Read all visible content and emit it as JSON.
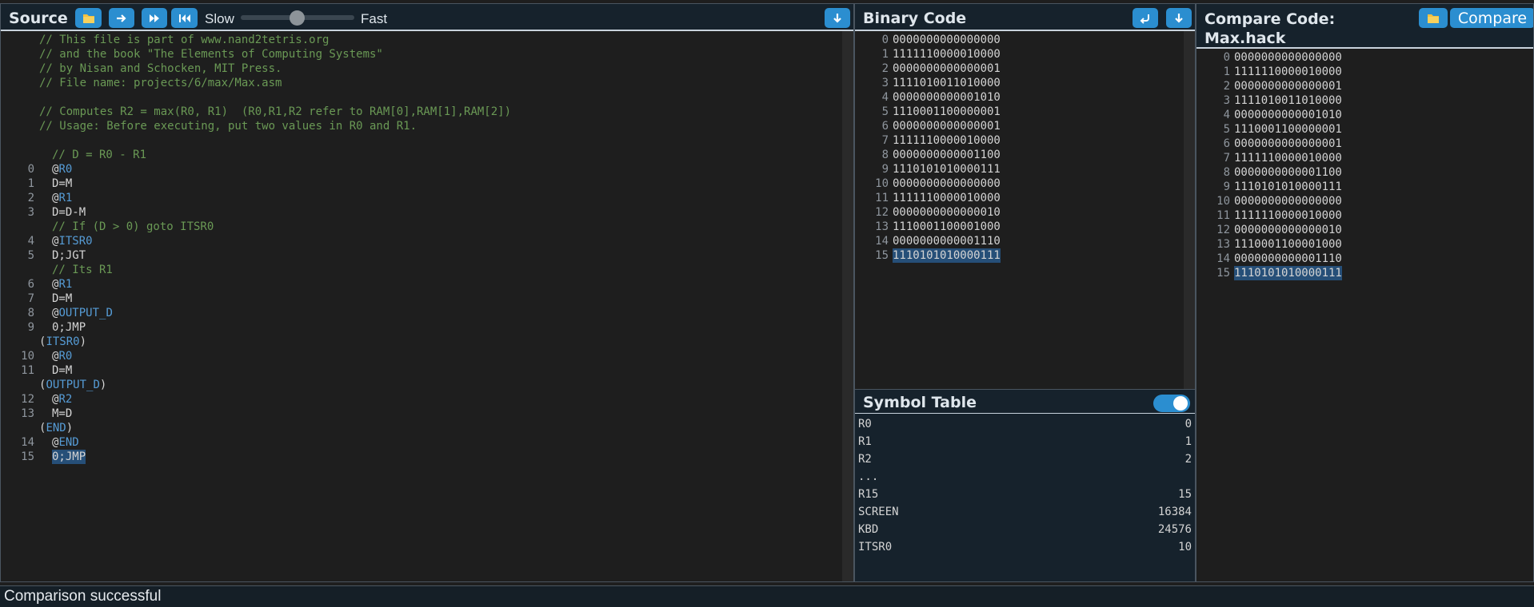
{
  "source": {
    "title": "Source",
    "speed_slow": "Slow",
    "speed_fast": "Fast",
    "speed_value": 0.6,
    "lines": [
      {
        "n": "",
        "t": "// This file is part of www.nand2tetris.org",
        "k": "comment",
        "indent": 0
      },
      {
        "n": "",
        "t": "// and the book \"The Elements of Computing Systems\"",
        "k": "comment",
        "indent": 0
      },
      {
        "n": "",
        "t": "// by Nisan and Schocken, MIT Press.",
        "k": "comment",
        "indent": 0
      },
      {
        "n": "",
        "t": "// File name: projects/6/max/Max.asm",
        "k": "comment",
        "indent": 0
      },
      {
        "n": "",
        "t": "",
        "k": "blank",
        "indent": 0
      },
      {
        "n": "",
        "t": "// Computes R2 = max(R0, R1)  (R0,R1,R2 refer to RAM[0],RAM[1],RAM[2])",
        "k": "comment",
        "indent": 0
      },
      {
        "n": "",
        "t": "// Usage: Before executing, put two values in R0 and R1.",
        "k": "comment",
        "indent": 0
      },
      {
        "n": "",
        "t": "",
        "k": "blank",
        "indent": 0
      },
      {
        "n": "",
        "t": "// D = R0 - R1",
        "k": "comment",
        "indent": 1
      },
      {
        "n": "0",
        "t": "R0",
        "k": "a",
        "indent": 1
      },
      {
        "n": "1",
        "t": "D=M",
        "k": "ins",
        "indent": 1
      },
      {
        "n": "2",
        "t": "R1",
        "k": "a",
        "indent": 1
      },
      {
        "n": "3",
        "t": "D=D-M",
        "k": "ins",
        "indent": 1
      },
      {
        "n": "",
        "t": "// If (D > 0) goto ITSR0",
        "k": "comment",
        "indent": 1
      },
      {
        "n": "4",
        "t": "ITSR0",
        "k": "a",
        "indent": 1
      },
      {
        "n": "5",
        "t": "D;JGT",
        "k": "ins",
        "indent": 1
      },
      {
        "n": "",
        "t": "// Its R1",
        "k": "comment",
        "indent": 1
      },
      {
        "n": "6",
        "t": "R1",
        "k": "a",
        "indent": 1
      },
      {
        "n": "7",
        "t": "D=M",
        "k": "ins",
        "indent": 1
      },
      {
        "n": "8",
        "t": "OUTPUT_D",
        "k": "a",
        "indent": 1
      },
      {
        "n": "9",
        "t": "0;JMP",
        "k": "ins",
        "indent": 1
      },
      {
        "n": "",
        "t": "ITSR0",
        "k": "label",
        "indent": 0
      },
      {
        "n": "10",
        "t": "R0",
        "k": "a",
        "indent": 1
      },
      {
        "n": "11",
        "t": "D=M",
        "k": "ins",
        "indent": 1
      },
      {
        "n": "",
        "t": "OUTPUT_D",
        "k": "label",
        "indent": 0
      },
      {
        "n": "12",
        "t": "R2",
        "k": "a",
        "indent": 1
      },
      {
        "n": "13",
        "t": "M=D",
        "k": "ins",
        "indent": 1
      },
      {
        "n": "",
        "t": "END",
        "k": "label",
        "indent": 0
      },
      {
        "n": "14",
        "t": "END",
        "k": "a",
        "indent": 1
      },
      {
        "n": "15",
        "t": "0;JMP",
        "k": "ins",
        "indent": 1,
        "hl": true
      }
    ]
  },
  "binary": {
    "title": "Binary Code",
    "rows": [
      [
        "0",
        "0000000000000000"
      ],
      [
        "1",
        "1111110000010000"
      ],
      [
        "2",
        "0000000000000001"
      ],
      [
        "3",
        "1111010011010000"
      ],
      [
        "4",
        "0000000000001010"
      ],
      [
        "5",
        "1110001100000001"
      ],
      [
        "6",
        "0000000000000001"
      ],
      [
        "7",
        "1111110000010000"
      ],
      [
        "8",
        "0000000000001100"
      ],
      [
        "9",
        "1110101010000111"
      ],
      [
        "10",
        "0000000000000000"
      ],
      [
        "11",
        "1111110000010000"
      ],
      [
        "12",
        "0000000000000010"
      ],
      [
        "13",
        "1110001100001000"
      ],
      [
        "14",
        "0000000000001110"
      ],
      [
        "15",
        "1110101010000111"
      ]
    ]
  },
  "symbol_table": {
    "title": "Symbol Table",
    "toggle_on": true,
    "rows": [
      [
        "R0",
        "0"
      ],
      [
        "R1",
        "1"
      ],
      [
        "R2",
        "2"
      ],
      [
        "...",
        ""
      ],
      [
        "R15",
        "15"
      ],
      [
        "SCREEN",
        "16384"
      ],
      [
        "KBD",
        "24576"
      ],
      [
        "ITSR0",
        "10"
      ]
    ]
  },
  "compare": {
    "title_line1": "Compare Code:",
    "title_line2": "Max.hack",
    "button_label": "Compare",
    "rows": [
      [
        "0",
        "0000000000000000"
      ],
      [
        "1",
        "1111110000010000"
      ],
      [
        "2",
        "0000000000000001"
      ],
      [
        "3",
        "1111010011010000"
      ],
      [
        "4",
        "0000000000001010"
      ],
      [
        "5",
        "1110001100000001"
      ],
      [
        "6",
        "0000000000000001"
      ],
      [
        "7",
        "1111110000010000"
      ],
      [
        "8",
        "0000000000001100"
      ],
      [
        "9",
        "1110101010000111"
      ],
      [
        "10",
        "0000000000000000"
      ],
      [
        "11",
        "1111110000010000"
      ],
      [
        "12",
        "0000000000000010"
      ],
      [
        "13",
        "1110001100001000"
      ],
      [
        "14",
        "0000000000001110"
      ],
      [
        "15",
        "1110101010000111"
      ]
    ]
  },
  "status": "Comparison successful",
  "colors": {
    "accent": "#2b8ed0",
    "comment": "#6a9955",
    "symbol": "#569cd6",
    "highlight": "#264f78"
  },
  "icons": {
    "open": "folder-icon",
    "step": "arrow-right-icon",
    "run": "fast-forward-icon",
    "reset": "rewind-icon",
    "download": "arrow-down-icon",
    "format": "return-arrow-icon"
  }
}
